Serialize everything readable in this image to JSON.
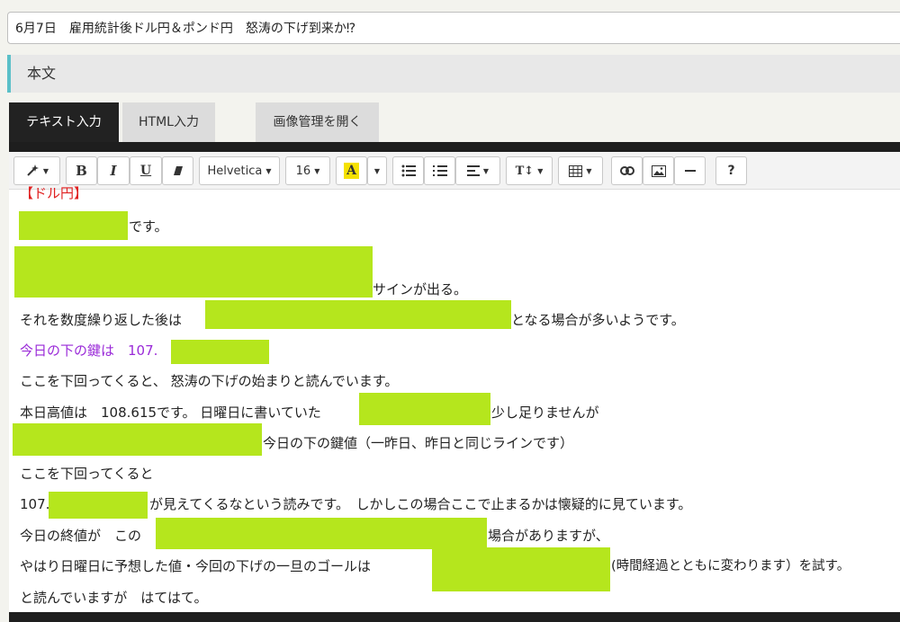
{
  "post_title": "6月7日　雇用統計後ドル円＆ポンド円　怒涛の下げ到来か⁉",
  "section_label": "本文",
  "tabs": {
    "text_input": "テキスト入力",
    "html_input": "HTML入力",
    "image_manager": "画像管理を開く"
  },
  "toolbar": {
    "bold": "B",
    "italic": "I",
    "underline": "U",
    "font_family": "Helvetica",
    "font_size": "16",
    "color": "A",
    "text_height": "T↕",
    "help": "?"
  },
  "content": {
    "line0": "【ドル円】",
    "line1": "です。",
    "line2": "サインが出る。",
    "line3a": "それを数度繰り返した後は",
    "line3b": "となる場合が多いようです。",
    "line4": "今日の下の鍵は　107.",
    "line5": "ここを下回ってくると、 怒涛の下げの始まりと読んでいます。",
    "line6a": "本日高値は　108.615です。 日曜日に書いていた",
    "line6b": "少し足りませんが",
    "line7": "今日の下の鍵値（一昨日、昨日と同じラインです）",
    "line8": "ここを下回ってくると",
    "line9a": "107.",
    "line9b": "が見えてくるなという読みです。　しかしこの場合ここで止まるかは懐疑的に見ています。",
    "line10a": "今日の終値が　この",
    "line10b": "場合がありますが、",
    "line11a": "やはり日曜日に予想した値・今回の下げの一旦のゴールは",
    "line11b": "(時間経過とともに変わります）を試す。",
    "line12": "と読んでいますが　はてはて。"
  },
  "colors": {
    "highlight": "#b5e61d",
    "accent_red": "#e02020",
    "accent_purple": "#9a2ad8",
    "tab_active_bg": "#222222",
    "section_border": "#5bc0c8",
    "color_button_bg": "#f5e100"
  }
}
